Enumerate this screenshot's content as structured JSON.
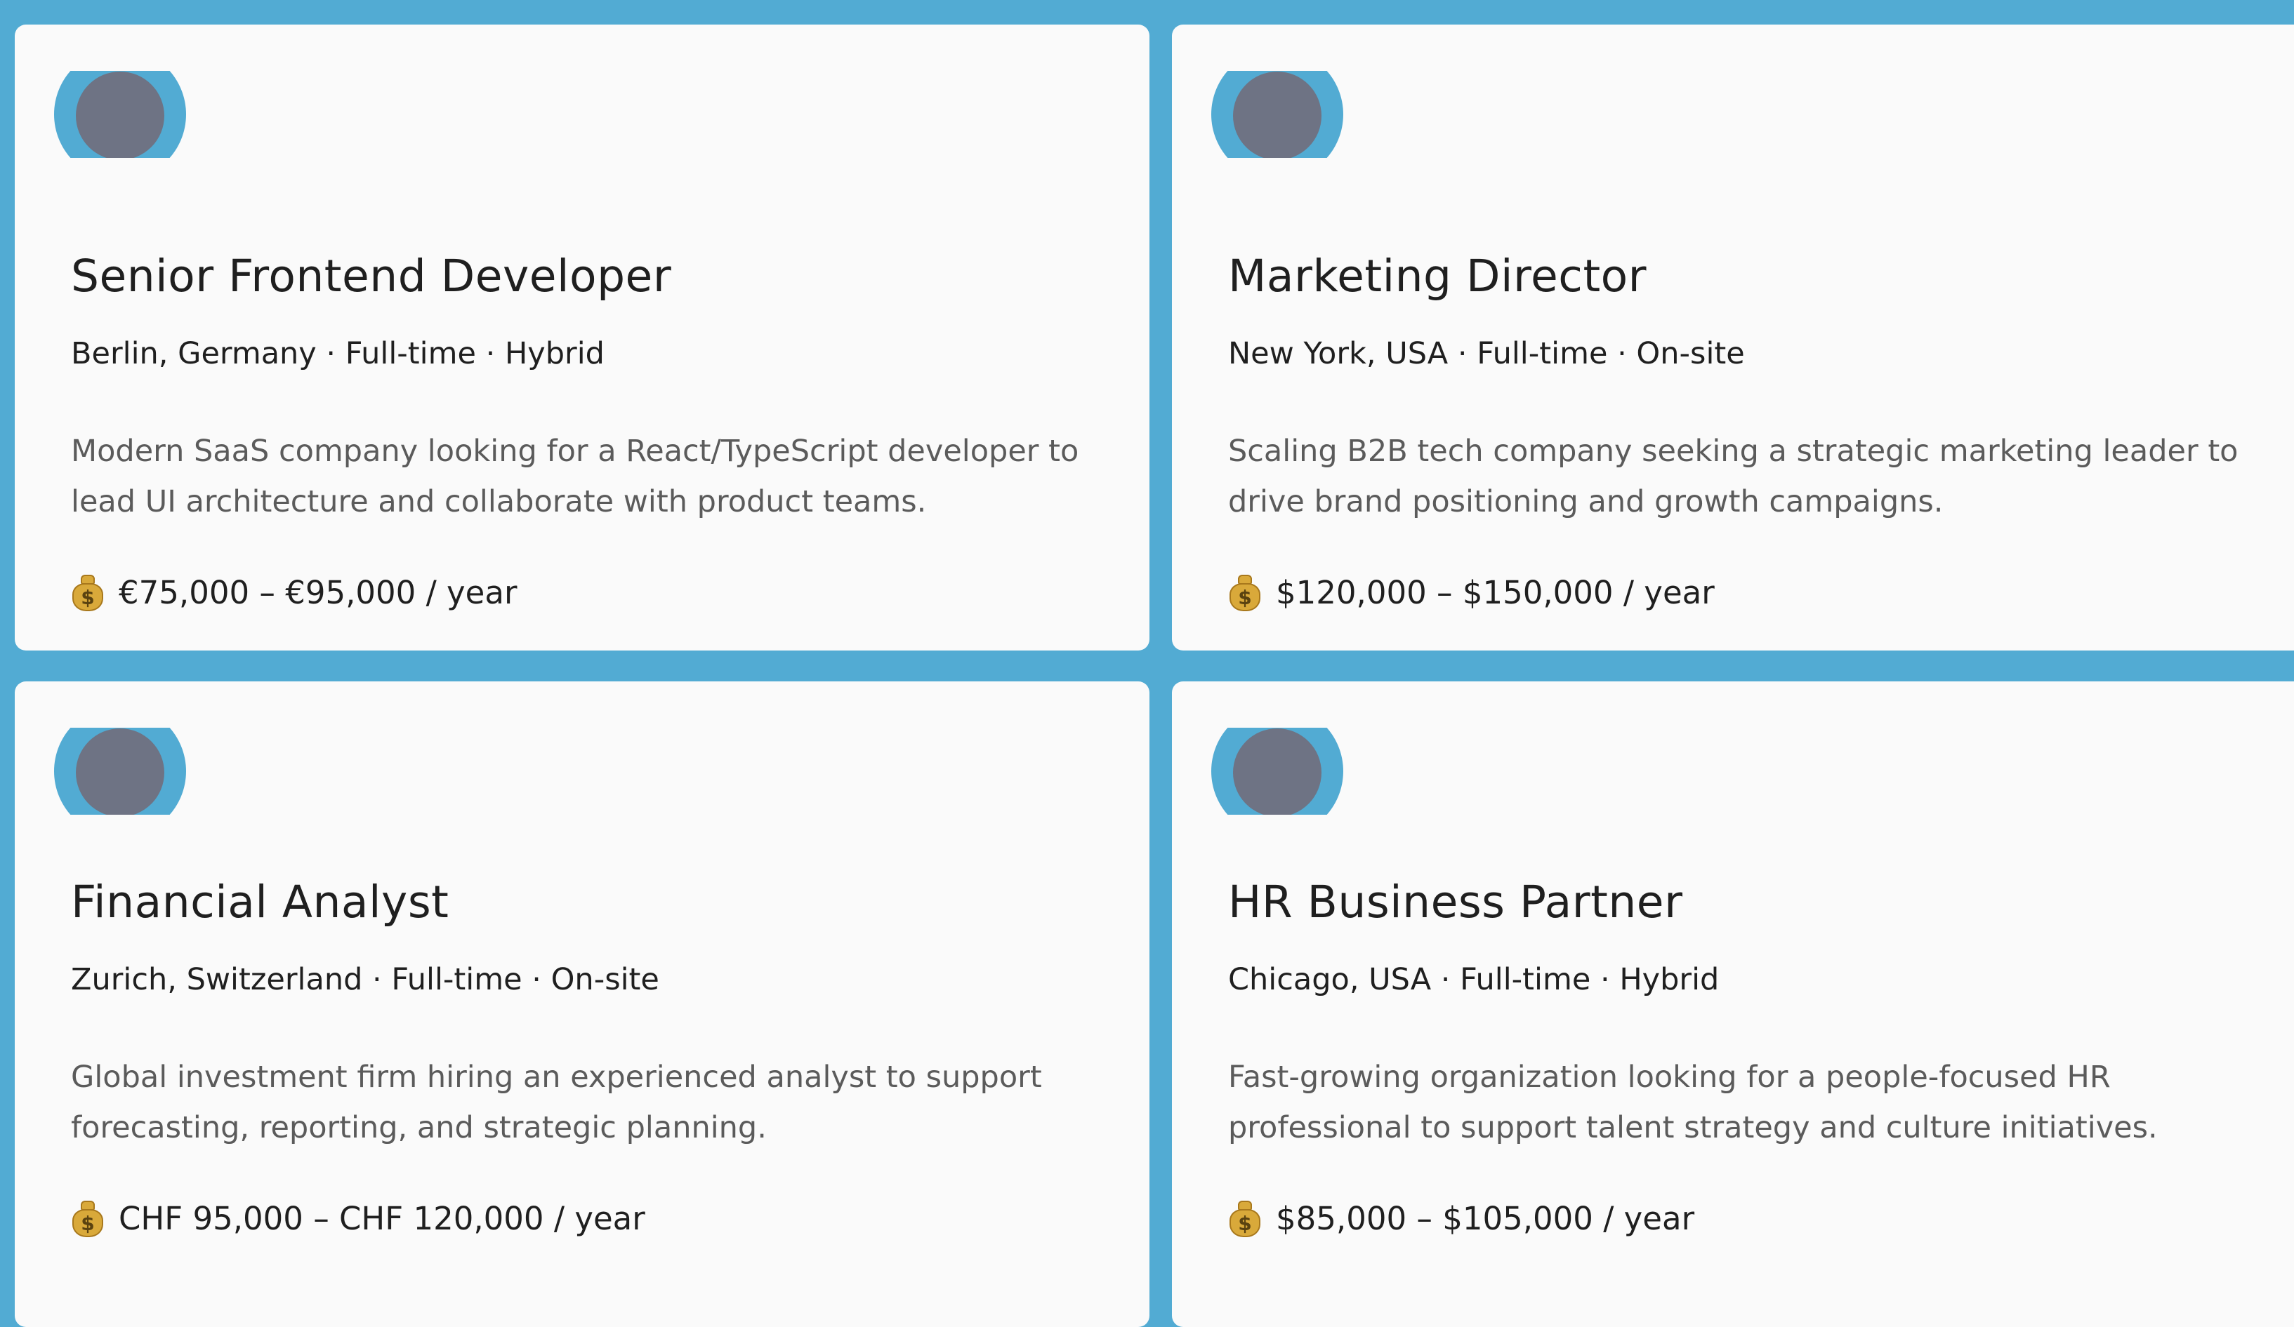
{
  "colors": {
    "background": "#52abd3",
    "card": "#fafafa",
    "logo_ring": "#52abd3",
    "logo_dot": "#6e7384",
    "title": "#1f1f1f",
    "description": "#5b5b5b"
  },
  "icons": {
    "logo": "company-logo-icon",
    "salary": "money-bag-icon"
  },
  "jobs": [
    {
      "title": "Senior Frontend Developer",
      "meta": "Berlin, Germany · Full-time · Hybrid",
      "description": "Modern SaaS company looking for a React/TypeScript developer to lead UI architecture and collaborate with product teams.",
      "salary": "€75,000 – €95,000 / year"
    },
    {
      "title": "Marketing Director",
      "meta": "New York, USA · Full-time · On-site",
      "description": "Scaling B2B tech company seeking a strategic marketing leader to drive brand positioning and growth campaigns.",
      "salary": "$120,000 – $150,000 / year"
    },
    {
      "title": "Financial Analyst",
      "meta": "Zurich, Switzerland · Full-time · On-site",
      "description": "Global investment firm hiring an experienced analyst to support forecasting, reporting, and strategic planning.",
      "salary": "CHF 95,000 – CHF 120,000 / year"
    },
    {
      "title": "HR Business Partner",
      "meta": "Chicago, USA · Full-time · Hybrid",
      "description": "Fast-growing organization looking for a people-focused HR professional to support talent strategy and culture initiatives.",
      "salary": "$85,000 – $105,000 / year"
    }
  ]
}
